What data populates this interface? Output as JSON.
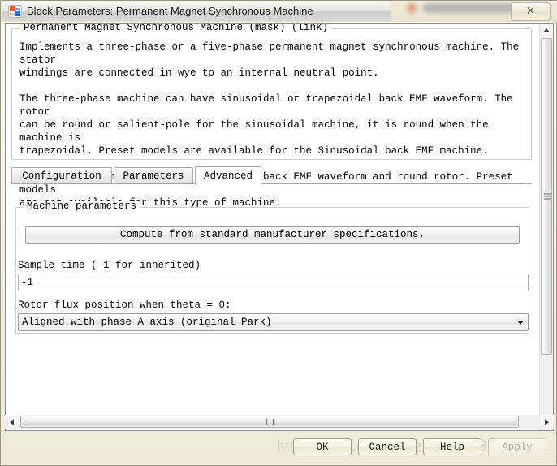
{
  "window": {
    "title": "Block Parameters: Permanent Magnet Synchronous Machine",
    "icon": "simulink-block-icon",
    "close_label": "✕"
  },
  "background_watermark": "https://blog.csdn.net/zy243752301",
  "description": {
    "legend": "Permanent Magnet Synchronous Machine (mask) (link)",
    "body": "Implements a three-phase or a five-phase permanent magnet synchronous machine. The stator\nwindings are connected in wye to an internal neutral point.\n\nThe three-phase machine can have sinusoidal or trapezoidal back EMF waveform. The rotor\ncan be round or salient-pole for the sinusoidal machine, it is round when the machine is\ntrapezoidal. Preset models are available for the Sinusoidal back EMF machine.\n\nThe five-phase machine has a sinusoidal back EMF waveform and round rotor. Preset models\nare not available for this type of machine."
  },
  "tabs": [
    {
      "label": "Configuration",
      "selected": false
    },
    {
      "label": "Parameters",
      "selected": false
    },
    {
      "label": "Advanced",
      "selected": true
    }
  ],
  "machine_parameters": {
    "legend": "Machine parameters",
    "compute_button": "Compute from standard manufacturer specifications.",
    "sample_time": {
      "label": "Sample time (-1 for inherited)",
      "value": "-1"
    },
    "rotor_flux_position": {
      "label": "Rotor flux position when theta = 0:",
      "value": "Aligned with phase A axis (original Park)"
    }
  },
  "footer_buttons": [
    {
      "label": "OK",
      "enabled": true
    },
    {
      "label": "Cancel",
      "enabled": true
    },
    {
      "label": "Help",
      "enabled": true
    },
    {
      "label": "Apply",
      "enabled": false
    }
  ],
  "scrollbars": {
    "vertical_position": "near-top",
    "horizontal_position": "centered"
  }
}
